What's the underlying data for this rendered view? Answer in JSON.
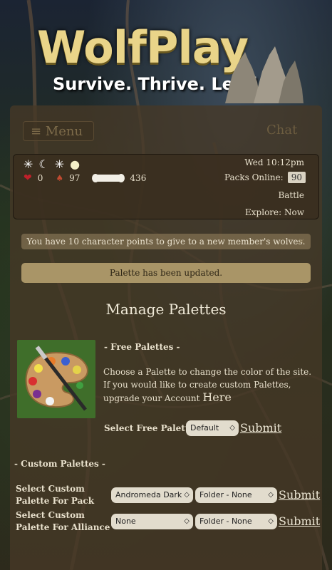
{
  "logo": {
    "title": "WolfPlay",
    "tagline": "Survive. Thrive. Lead."
  },
  "nav": {
    "menu_label": "≡ Menu",
    "chat_label": "Chat"
  },
  "status": {
    "phases": [
      "✳",
      "☾",
      "✳",
      "●"
    ],
    "hearts": "0",
    "food": "97",
    "bones": "436",
    "time": "Wed 10:12pm",
    "packs_online_label": "Packs Online:",
    "packs_online_count": "90",
    "battle": "Battle",
    "explore": "Explore: Now"
  },
  "alerts": {
    "points": "You have 10 character points to give to a new member's wolves.",
    "close": "✕",
    "updated": "Palette has been updated."
  },
  "page": {
    "title": "Manage Palettes"
  },
  "free": {
    "section_label": "- Free Palettes -",
    "line1": "Choose a Palette to change the color of the site.",
    "line2": "If you would like to create custom Palettes, upgrade your Account",
    "here_link": "Here",
    "select_label": "Select Free Palette",
    "selected": "Default",
    "submit": "Submit"
  },
  "custom": {
    "section_label": "- Custom Palettes -",
    "pack_label_1": "Select Custom",
    "pack_label_2": "Palette For Pack",
    "pack_palette": "Andromeda Dark",
    "pack_folder": "Folder - None",
    "pack_submit": "Submit",
    "alliance_label_1": "Select Custom",
    "alliance_label_2": "Palette For Alliance",
    "alliance_palette": "None",
    "alliance_folder": "Folder - None",
    "alliance_submit": "Submit"
  },
  "icons": {
    "caret": "◇",
    "heart": "❤",
    "mushroom": "♠"
  },
  "colors": {
    "panel": "#463826",
    "gold": "#e9d489",
    "alert": "#a99567"
  }
}
